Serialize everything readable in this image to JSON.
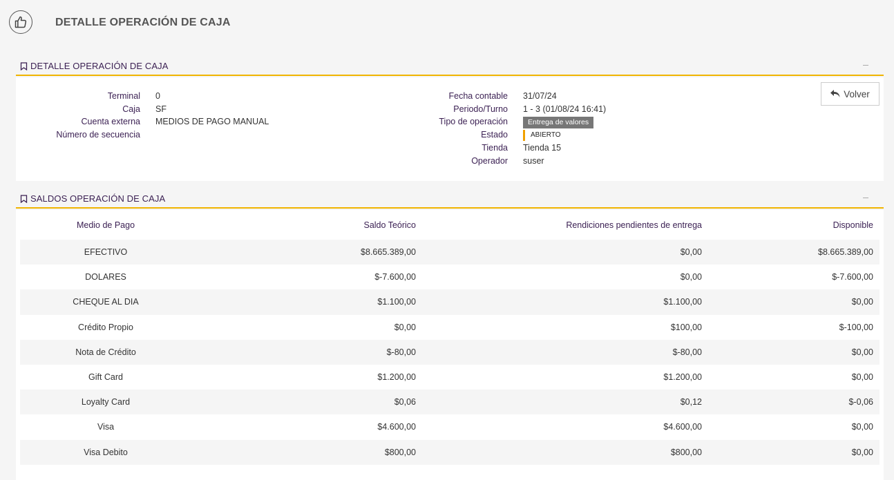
{
  "header": {
    "title": "DETALLE OPERACIÓN DE CAJA",
    "icon": "thumbs-up-icon"
  },
  "detalle": {
    "section_title": "DETALLE OPERACIÓN DE CAJA",
    "left": [
      {
        "label": "Terminal",
        "value": "0"
      },
      {
        "label": "Caja",
        "value": "SF"
      },
      {
        "label": "Cuenta externa",
        "value": "MEDIOS DE PAGO MANUAL"
      },
      {
        "label": "Número de secuencia",
        "value": ""
      }
    ],
    "right": {
      "fecha_label": "Fecha contable",
      "fecha_value": "31/07/24",
      "periodo_label": "Periodo/Turno",
      "periodo_value": "1 - 3 (01/08/24 16:41)",
      "tipo_label": "Tipo de operación",
      "tipo_value": "Entrega de valores",
      "estado_label": "Estado",
      "estado_value": "ABIERTO",
      "tienda_label": "Tienda",
      "tienda_value": "Tienda 15",
      "operador_label": "Operador",
      "operador_value": "suser"
    },
    "volver_label": "Volver",
    "colors": {
      "accent": "#f0b400",
      "estado_bar": "#f0a000",
      "badge_bg": "#777777",
      "label": "#3a1f52"
    }
  },
  "saldos": {
    "section_title": "SALDOS OPERACIÓN DE CAJA",
    "columns": [
      "Medio de Pago",
      "Saldo Teórico",
      "Rendiciones pendientes de entrega",
      "Disponible"
    ],
    "rows": [
      [
        "EFECTIVO",
        "$8.665.389,00",
        "$0,00",
        "$8.665.389,00"
      ],
      [
        "DOLARES",
        "$-7.600,00",
        "$0,00",
        "$-7.600,00"
      ],
      [
        "CHEQUE AL DIA",
        "$1.100,00",
        "$1.100,00",
        "$0,00"
      ],
      [
        "Crédito Propio",
        "$0,00",
        "$100,00",
        "$-100,00"
      ],
      [
        "Nota de Crédito",
        "$-80,00",
        "$-80,00",
        "$0,00"
      ],
      [
        "Gift Card",
        "$1.200,00",
        "$1.200,00",
        "$0,00"
      ],
      [
        "Loyalty Card",
        "$0,06",
        "$0,12",
        "$-0,06"
      ],
      [
        "Visa",
        "$4.600,00",
        "$4.600,00",
        "$0,00"
      ],
      [
        "Visa Debito",
        "$800,00",
        "$800,00",
        "$0,00"
      ]
    ]
  }
}
